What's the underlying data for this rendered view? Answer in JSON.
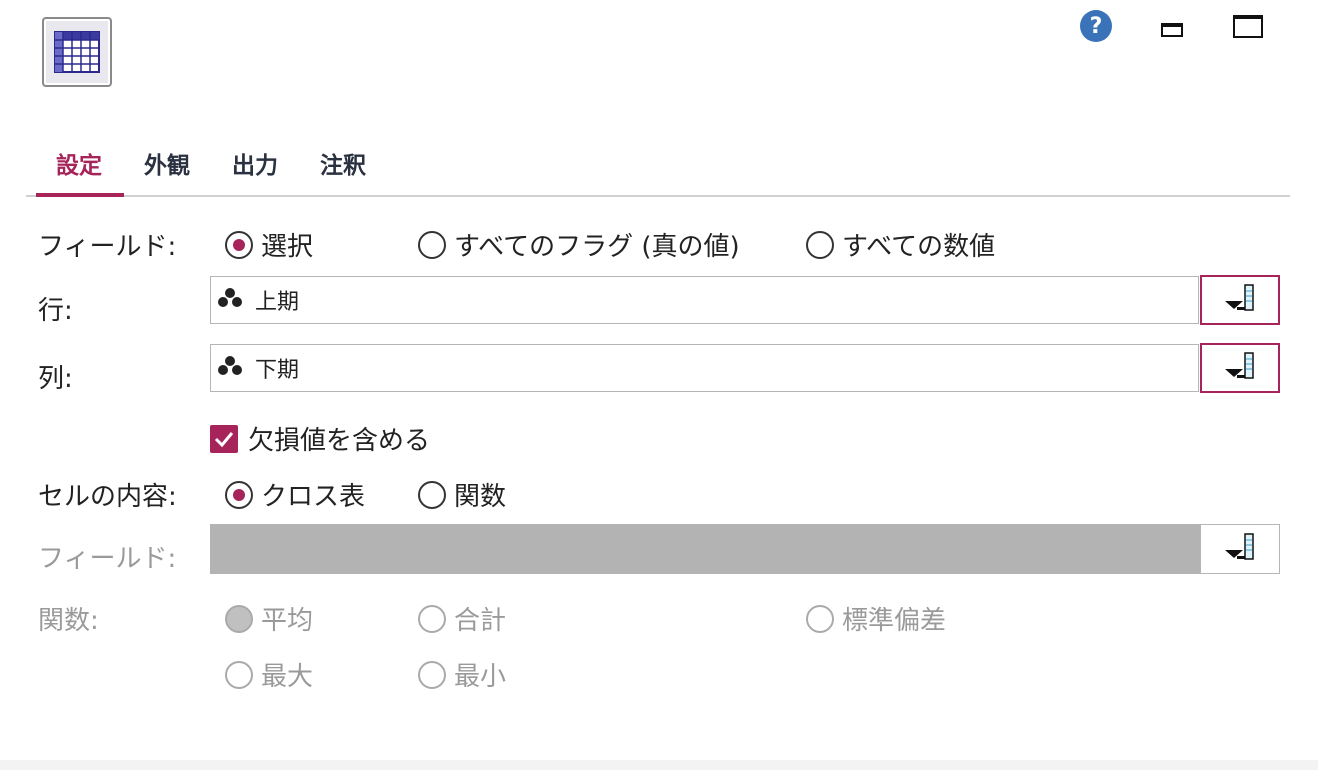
{
  "window": {
    "icons": {
      "app": "table-grid-icon",
      "help": "help-icon",
      "minimize": "minimize-icon",
      "maximize": "maximize-icon"
    },
    "help_label": "?"
  },
  "tabs": [
    {
      "label": "設定",
      "active": true
    },
    {
      "label": "外観",
      "active": false
    },
    {
      "label": "出力",
      "active": false
    },
    {
      "label": "注釈",
      "active": false
    }
  ],
  "form": {
    "fields_label": "フィールド:",
    "fields_options": [
      {
        "label": "選択",
        "selected": true
      },
      {
        "label": "すべてのフラグ (真の値)",
        "selected": false
      },
      {
        "label": "すべての数値",
        "selected": false
      }
    ],
    "row_label": "行:",
    "row_value": "上期",
    "column_label": "列:",
    "column_value": "下期",
    "include_missing_label": "欠損値を含める",
    "include_missing_checked": true,
    "cell_contents_label": "セルの内容:",
    "cell_contents_options": [
      {
        "label": "クロス表",
        "selected": true
      },
      {
        "label": "関数",
        "selected": false
      }
    ],
    "function_field_label": "フィールド:",
    "function_field_value": "",
    "function_label": "関数:",
    "function_options": [
      {
        "label": "平均",
        "selected": true
      },
      {
        "label": "合計",
        "selected": false
      },
      {
        "label": "標準偏差",
        "selected": false
      },
      {
        "label": "最大",
        "selected": false
      },
      {
        "label": "最小",
        "selected": false
      }
    ]
  },
  "colors": {
    "accent": "#a6245a",
    "disabled": "#b3b3b3",
    "help_blue": "#3b73b9"
  }
}
